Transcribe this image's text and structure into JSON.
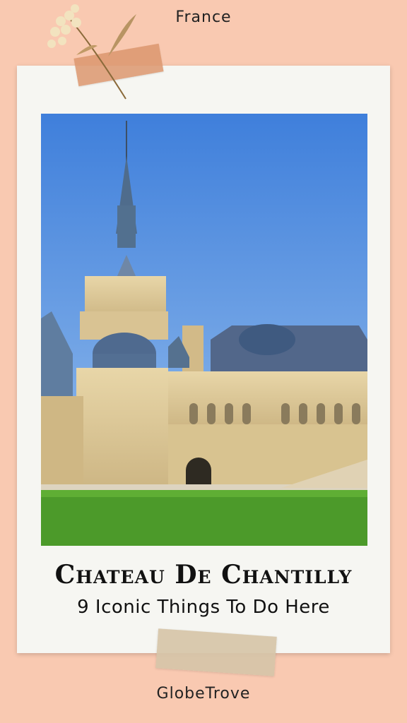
{
  "header": {
    "location": "France"
  },
  "card": {
    "title": "Chateau De Chantilly",
    "subtitle": "9 Iconic Things To Do Here"
  },
  "footer": {
    "brand": "GlobeTrove"
  },
  "colors": {
    "background": "#f9c9b1",
    "card": "#f6f6f2",
    "sky": "#5f97e3",
    "lawn": "#4c9a2a",
    "stone": "#dcc89c"
  },
  "decorations": {
    "top": "dried-flower-with-tape",
    "bottom": "masking-tape"
  }
}
